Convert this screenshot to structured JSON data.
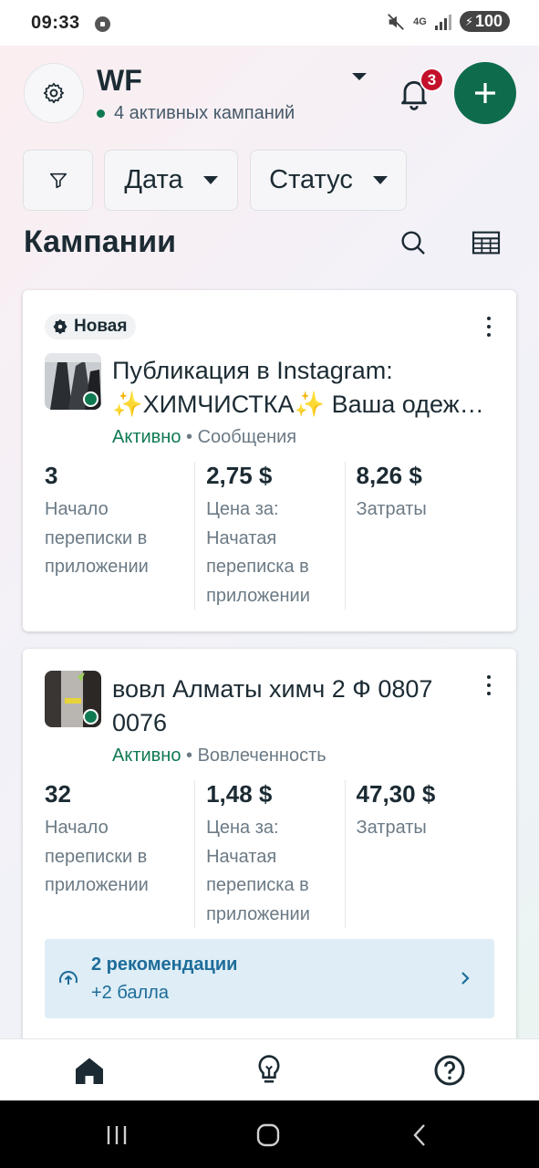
{
  "status_bar": {
    "time": "09:33",
    "network": "4G",
    "battery": "100",
    "icons": [
      "mute-icon",
      "signal-icon",
      "battery-icon"
    ]
  },
  "header": {
    "account_name": "WF",
    "account_status": "4 активных кампаний",
    "notification_count": "3"
  },
  "filters": {
    "filter_icon": "filter-icon",
    "date_label": "Дата",
    "status_label": "Статус"
  },
  "section": {
    "title": "Кампании"
  },
  "campaigns": [
    {
      "chip": "Новая",
      "title": "Публикация в Instagram: ✨ХИМЧИСТКА✨ Ваша одеж…",
      "status": "Активно",
      "objective": "Сообщения",
      "metrics": [
        {
          "value": "3",
          "label": "Начало переписки в приложении"
        },
        {
          "value": "2,75 $",
          "label": "Цена за: Начатая переписка в приложении"
        },
        {
          "value": "8,26 $",
          "label": "Затраты"
        }
      ]
    },
    {
      "title": "вовл Алматы химч 2 Ф 0807 0076",
      "status": "Активно",
      "objective": "Вовлеченность",
      "metrics": [
        {
          "value": "32",
          "label": "Начало переписки в приложении"
        },
        {
          "value": "1,48 $",
          "label": "Цена за: Начатая переписка в приложении"
        },
        {
          "value": "47,30 $",
          "label": "Затраты"
        }
      ],
      "recommendation": {
        "title": "2 рекомендации",
        "subtitle": "+2 балла"
      }
    }
  ],
  "colors": {
    "brand_green": "#0e6b4c",
    "active_green": "#0f7a52",
    "badge_red": "#c3102b",
    "reco_blue": "#1d6c99",
    "reco_bg": "#deedf6"
  }
}
